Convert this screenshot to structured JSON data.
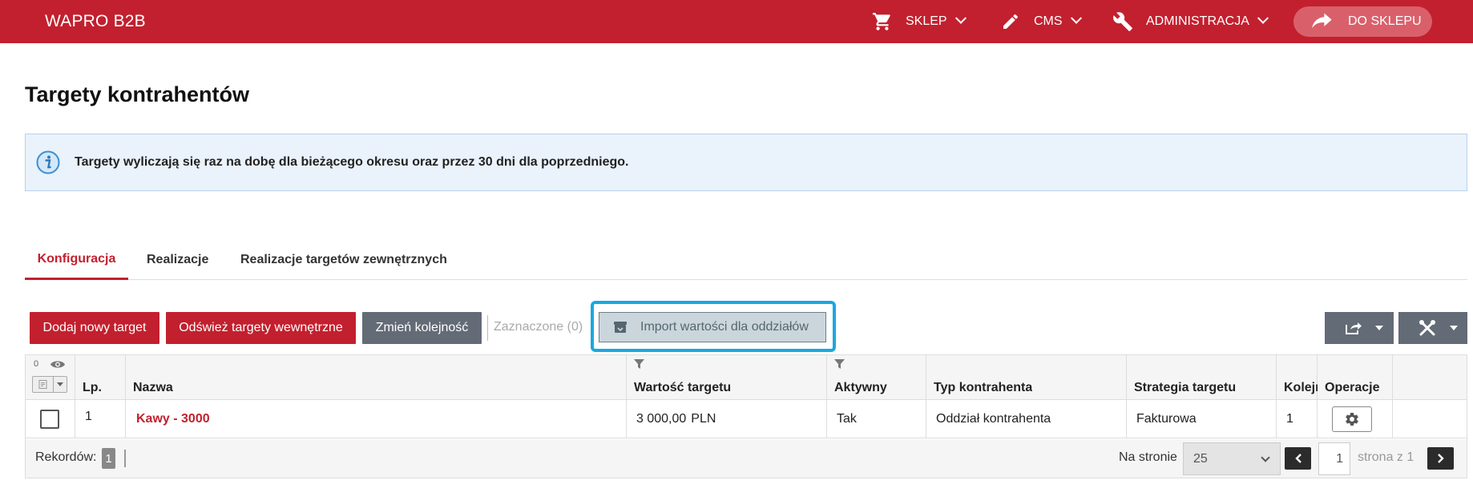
{
  "header": {
    "brand": "WAPRO B2B",
    "nav": [
      {
        "label": "SKLEP",
        "icon": "cart-icon"
      },
      {
        "label": "CMS",
        "icon": "pencil-icon"
      },
      {
        "label": "ADMINISTRACJA",
        "icon": "wrench-icon"
      }
    ],
    "to_shop": {
      "label": "DO SKLEPU",
      "icon": "share-arrow-icon"
    }
  },
  "page": {
    "title": "Targety kontrahentów"
  },
  "alert": {
    "text": "Targety wyliczają się raz na dobę dla bieżącego okresu oraz przez 30 dni dla poprzedniego.",
    "icon": "info-icon"
  },
  "tabs": [
    {
      "label": "Konfiguracja",
      "active": true
    },
    {
      "label": "Realizacje",
      "active": false
    },
    {
      "label": "Realizacje targetów zewnętrznych",
      "active": false
    }
  ],
  "toolbar": {
    "add_label": "Dodaj nowy target",
    "refresh_label": "Odśwież targety wewnętrzne",
    "reorder_label": "Zmień kolejność",
    "selected_label": "Zaznaczone (0)",
    "import_label": "Import wartości dla oddziałów"
  },
  "colors": {
    "brand": "#c2202e",
    "gray_button": "#636b76",
    "highlight": "#1aa8e0"
  },
  "table": {
    "select_count": "0",
    "columns": {
      "lp": "Lp.",
      "name": "Nazwa",
      "value": "Wartość targetu",
      "active": "Aktywny",
      "customer_type": "Typ kontrahenta",
      "strategy": "Strategia targetu",
      "order": "Kolejność",
      "operations": "Operacje"
    },
    "rows": [
      {
        "lp": "1",
        "name": "Kawy - 3000",
        "value": "3 000,00",
        "currency": "PLN",
        "active": "Tak",
        "customer_type": "Oddział kontrahenta",
        "strategy": "Fakturowa",
        "order": "1"
      }
    ],
    "footer": {
      "records_label": "Rekordów:",
      "records_count": "1",
      "per_page_label": "Na stronie",
      "per_page_value": "25",
      "page_value": "1",
      "page_of": "strona z 1"
    }
  }
}
